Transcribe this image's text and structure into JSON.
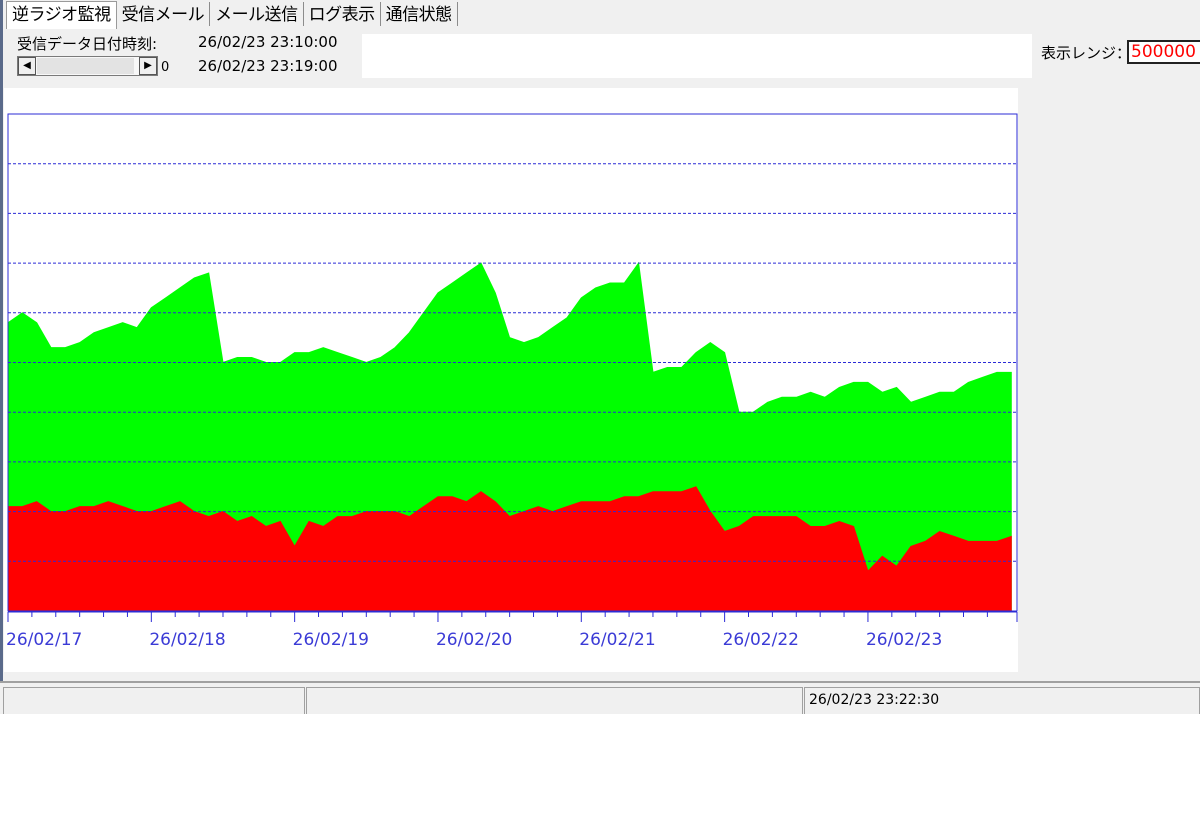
{
  "tabs": [
    {
      "label": "逆ラジオ監視"
    },
    {
      "label": "受信メール"
    },
    {
      "label": "メール送信"
    },
    {
      "label": "ログ表示"
    },
    {
      "label": "通信状態"
    }
  ],
  "header": {
    "recv_label": "受信データ日付時刻:",
    "recv_time1": "26/02/23 23:10:00",
    "recv_time2": "26/02/23 23:19:00",
    "scroll_value": "0",
    "range_label": "表示レンジ：",
    "range_value": "500000"
  },
  "chart_data": {
    "type": "area",
    "x_tick_labels": [
      "26/02/17",
      "26/02/18",
      "26/02/19",
      "26/02/20",
      "26/02/21",
      "26/02/22",
      "26/02/23"
    ],
    "grid": true,
    "colors": {
      "red_series": "#ff0000",
      "green_series": "#00ff00",
      "grid": "#2b2bd6",
      "frame": "#2b2bd6",
      "tick_text": "#3b3bd6"
    },
    "series": [
      {
        "color": "#ff0000",
        "x": [
          0,
          0.1,
          0.2,
          0.3,
          0.4,
          0.5,
          0.6,
          0.7,
          0.8,
          0.9,
          1,
          1.1,
          1.2,
          1.3,
          1.4,
          1.5,
          1.6,
          1.7,
          1.8,
          1.9,
          2,
          2.1,
          2.2,
          2.3,
          2.4,
          2.5,
          2.6,
          2.7,
          2.8,
          2.9,
          3,
          3.1,
          3.2,
          3.3,
          3.4,
          3.5,
          3.6,
          3.7,
          3.8,
          3.9,
          4,
          4.1,
          4.2,
          4.3,
          4.4,
          4.5,
          4.6,
          4.7,
          4.8,
          4.9,
          5,
          5.1,
          5.2,
          5.3,
          5.4,
          5.5,
          5.6,
          5.7,
          5.8,
          5.9,
          6,
          6.1,
          6.2,
          6.3,
          6.4,
          6.5,
          6.6,
          6.7,
          6.8,
          6.9,
          7
        ],
        "values": [
          0.21,
          0.21,
          0.22,
          0.2,
          0.2,
          0.21,
          0.21,
          0.22,
          0.21,
          0.2,
          0.2,
          0.21,
          0.22,
          0.2,
          0.19,
          0.2,
          0.18,
          0.19,
          0.17,
          0.18,
          0.13,
          0.18,
          0.17,
          0.19,
          0.19,
          0.2,
          0.2,
          0.2,
          0.19,
          0.21,
          0.23,
          0.23,
          0.22,
          0.24,
          0.22,
          0.19,
          0.2,
          0.21,
          0.2,
          0.21,
          0.22,
          0.22,
          0.22,
          0.23,
          0.23,
          0.24,
          0.24,
          0.24,
          0.25,
          0.2,
          0.16,
          0.17,
          0.19,
          0.19,
          0.19,
          0.19,
          0.17,
          0.17,
          0.18,
          0.17,
          0.08,
          0.11,
          0.09,
          0.13,
          0.14,
          0.16,
          0.15,
          0.14,
          0.14,
          0.14,
          0.15
        ]
      },
      {
        "color": "#00ff00",
        "x": [
          0,
          0.1,
          0.2,
          0.3,
          0.4,
          0.5,
          0.6,
          0.7,
          0.8,
          0.9,
          1,
          1.1,
          1.2,
          1.3,
          1.4,
          1.5,
          1.6,
          1.7,
          1.8,
          1.9,
          2,
          2.1,
          2.2,
          2.3,
          2.4,
          2.5,
          2.6,
          2.7,
          2.8,
          2.9,
          3,
          3.1,
          3.2,
          3.3,
          3.4,
          3.5,
          3.6,
          3.7,
          3.8,
          3.9,
          4,
          4.1,
          4.2,
          4.3,
          4.4,
          4.5,
          4.6,
          4.7,
          4.8,
          4.9,
          5,
          5.1,
          5.2,
          5.3,
          5.4,
          5.5,
          5.6,
          5.7,
          5.8,
          5.9,
          6,
          6.1,
          6.2,
          6.3,
          6.4,
          6.5,
          6.6,
          6.7,
          6.8,
          6.9,
          7
        ],
        "values": [
          0.58,
          0.6,
          0.58,
          0.53,
          0.53,
          0.54,
          0.56,
          0.57,
          0.58,
          0.57,
          0.61,
          0.63,
          0.65,
          0.67,
          0.68,
          0.5,
          0.51,
          0.51,
          0.5,
          0.5,
          0.52,
          0.52,
          0.53,
          0.52,
          0.51,
          0.5,
          0.51,
          0.53,
          0.56,
          0.6,
          0.64,
          0.66,
          0.68,
          0.7,
          0.64,
          0.55,
          0.54,
          0.55,
          0.57,
          0.59,
          0.63,
          0.65,
          0.66,
          0.66,
          0.7,
          0.48,
          0.49,
          0.49,
          0.52,
          0.54,
          0.52,
          0.4,
          0.4,
          0.42,
          0.43,
          0.43,
          0.44,
          0.43,
          0.45,
          0.46,
          0.46,
          0.44,
          0.45,
          0.42,
          0.43,
          0.44,
          0.44,
          0.46,
          0.47,
          0.48,
          0.48
        ]
      }
    ]
  },
  "status": {
    "timestamp": "26/02/23 23:22:30"
  }
}
